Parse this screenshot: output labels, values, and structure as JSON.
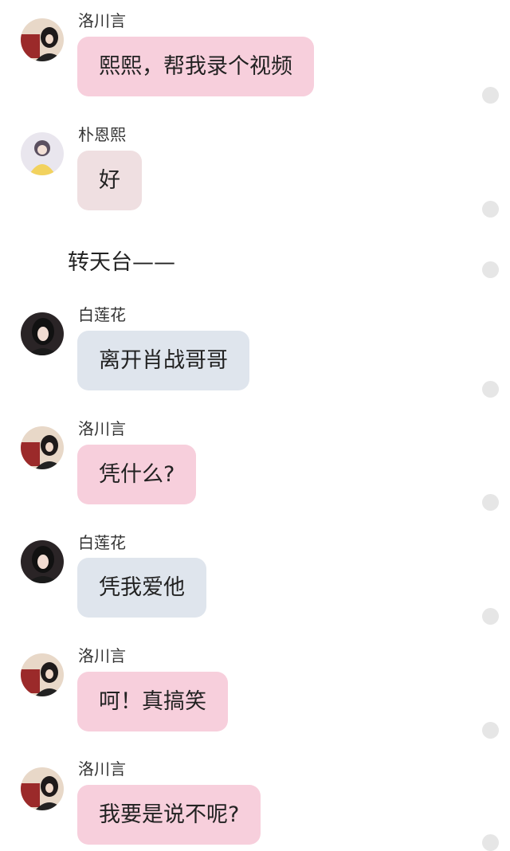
{
  "names": {
    "luo": "洛川言",
    "pu": "朴恩熙",
    "bai": "白莲花"
  },
  "messages": [
    {
      "sender": "洛川言",
      "text": "熙熙，帮我录个视频",
      "avatar": "luo-avatar"
    },
    {
      "sender": "朴恩熙",
      "text": "好",
      "avatar": "pu-avatar"
    },
    {
      "sender": "白莲花",
      "text": "离开肖战哥哥",
      "avatar": "bai-avatar"
    },
    {
      "sender": "洛川言",
      "text": "凭什么?",
      "avatar": "luo-avatar"
    },
    {
      "sender": "白莲花",
      "text": "凭我爱他",
      "avatar": "bai-avatar"
    },
    {
      "sender": "洛川言",
      "text": "呵！真搞笑",
      "avatar": "luo-avatar"
    },
    {
      "sender": "洛川言",
      "text": "我要是说不呢?",
      "avatar": "luo-avatar"
    }
  ],
  "narration": "转天台——",
  "colors": {
    "bubble_pink": "#f7cfdc",
    "bubble_blush": "#efdfe1",
    "bubble_grey": "#dfe5ed",
    "status_dot": "#e6e6e6"
  }
}
